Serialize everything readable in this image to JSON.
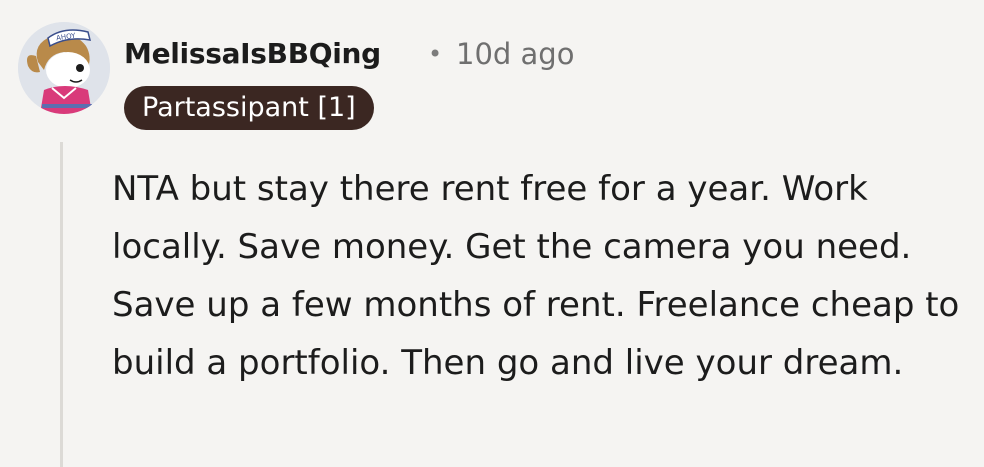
{
  "comment": {
    "author": "MelissaIsBBQing",
    "separator": "•",
    "time_ago": "10d ago",
    "flair": "Partassipant [1]",
    "avatar_hat_text": "AHOY",
    "body": "NTA but stay there rent free for a year. Work locally. Save money. Get the camera you need. Save up a few months of rent. Freelance cheap to build a portfolio. Then go and live your dream."
  },
  "colors": {
    "background": "#f5f4f2",
    "flair_background": "#3b2722",
    "flair_text": "#ffffff",
    "thread_line": "#dcdad6",
    "meta_text": "#6f6f6f"
  },
  "icons": {
    "avatar": "avatar-sailor-character-icon"
  }
}
